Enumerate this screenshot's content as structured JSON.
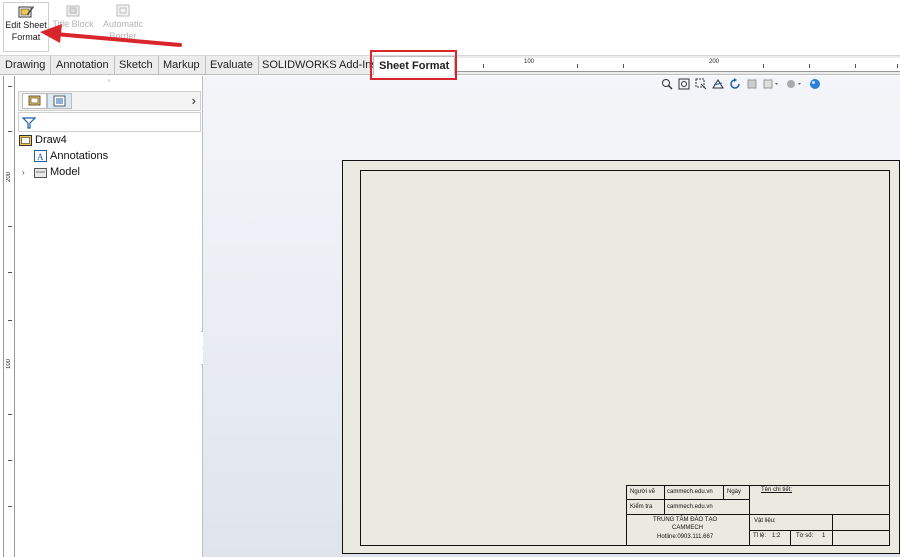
{
  "ribbon": {
    "buttons": [
      {
        "label_line1": "Edit Sheet",
        "label_line2": "Format",
        "state": "active",
        "icon": "edit-sheet-format-icon"
      },
      {
        "label_line1": "Title Block",
        "label_line2": "",
        "state": "disabled",
        "icon": "title-block-icon"
      },
      {
        "label_line1": "Automatic",
        "label_line2": "Border",
        "state": "disabled",
        "icon": "automatic-border-icon"
      }
    ]
  },
  "tabs": [
    {
      "label": "Drawing"
    },
    {
      "label": "Annotation"
    },
    {
      "label": "Sketch"
    },
    {
      "label": "Markup"
    },
    {
      "label": "Evaluate"
    },
    {
      "label": "SOLIDWORKS Add-Ins"
    },
    {
      "label": "Sheet Format",
      "selected": true
    }
  ],
  "ruler_top": {
    "labels": [
      "100",
      "200"
    ]
  },
  "ruler_left": {
    "labels": [
      "200",
      "100"
    ]
  },
  "feature_tree": {
    "root": "Draw4",
    "items": [
      {
        "label": "Annotations",
        "icon": "annotations-icon"
      },
      {
        "label": "Model",
        "icon": "model-icon"
      }
    ]
  },
  "title_block": {
    "nguoi_ve_label": "Người vẽ",
    "nguoi_ve_value": "cammech.edu.vn",
    "ngay_label": "Ngày",
    "ten_chi_tiet_label": "Tên chi tiết:",
    "kiem_tra_label": "Kiểm tra",
    "kiem_tra_value": "cammech.edu.vn",
    "org_line1": "TRUNG TÂM ĐÀO TẠO",
    "org_line2": "CAMMECH",
    "org_line3": "Hotline:0903.111.667",
    "vat_lieu_label": "Vật liệu:",
    "ti_le_label": "Tỉ lệ:",
    "ti_le_value": "1:2",
    "to_so_label": "Tờ số:",
    "to_so_value": "1"
  },
  "colors": {
    "highlight": "#d9262b",
    "sheet_bg": "#eaeae0",
    "accent": "#1f5fa8"
  }
}
